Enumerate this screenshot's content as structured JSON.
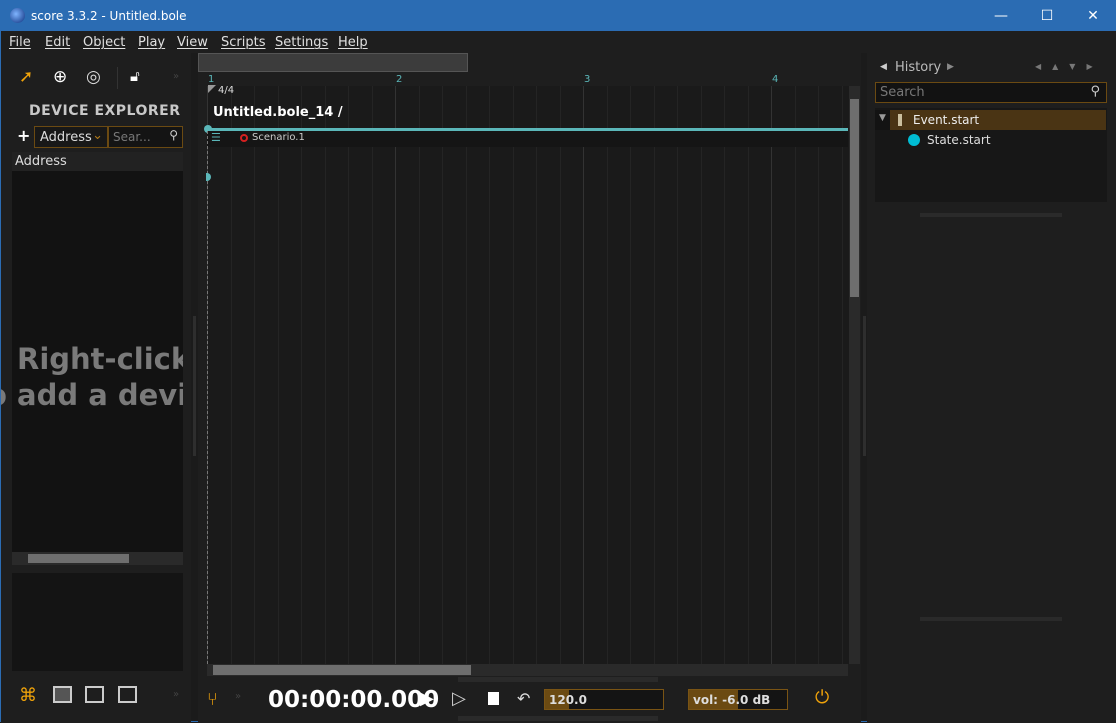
{
  "window": {
    "title": "score 3.3.2 - Untitled.bole",
    "minimize": "—",
    "maximize": "☐",
    "close": "✕"
  },
  "menu": [
    "File",
    "Edit",
    "Object",
    "Play",
    "View",
    "Scripts",
    "Settings",
    "Help"
  ],
  "device_explorer": {
    "title": "DEVICE EXPLORER",
    "add": "+",
    "filter": "Address",
    "search_placeholder": "Sear...",
    "column": "Address",
    "hint_line1": "Right-click",
    "hint_line2": "o add a devic"
  },
  "timeline": {
    "bars": [
      "1",
      "2",
      "3",
      "4"
    ],
    "time_signature": "4/4",
    "interval_title": "Untitled.bole_14 /",
    "process": "Scenario.1"
  },
  "history": {
    "title": "History",
    "search_placeholder": "Search",
    "items": [
      {
        "label": "Event.start",
        "selected": true
      },
      {
        "label": "State.start"
      }
    ]
  },
  "transport": {
    "timecode": "00:00:00.000",
    "tempo": "120.0",
    "tempo_fraction": 0.2,
    "volume": "vol: -6.0 dB",
    "volume_fraction": 0.5
  },
  "colors": {
    "accent": "#f0a30a",
    "titlebar": "#2b6cb3",
    "interval": "#5bb7b9",
    "state": "#00bcd4",
    "selection": "#4a3414"
  }
}
